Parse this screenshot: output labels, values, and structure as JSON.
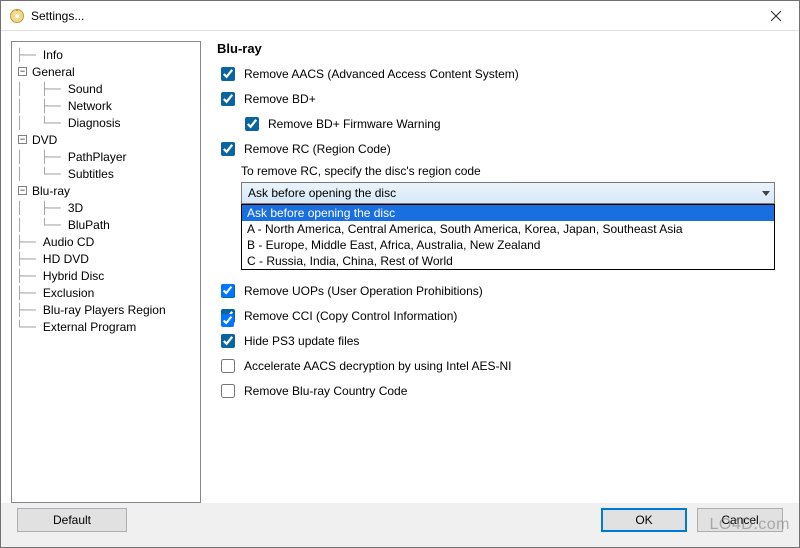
{
  "window": {
    "title": "Settings...",
    "close_label": "×"
  },
  "tree": {
    "items": [
      {
        "label": "Info",
        "depth": 1,
        "expander": "",
        "last": false
      },
      {
        "label": "General",
        "depth": 1,
        "expander": "-",
        "last": false
      },
      {
        "label": "Sound",
        "depth": 2,
        "expander": "",
        "last": false,
        "parentHasNext": true
      },
      {
        "label": "Network",
        "depth": 2,
        "expander": "",
        "last": false,
        "parentHasNext": true
      },
      {
        "label": "Diagnosis",
        "depth": 2,
        "expander": "",
        "last": true,
        "parentHasNext": true
      },
      {
        "label": "DVD",
        "depth": 1,
        "expander": "-",
        "last": false
      },
      {
        "label": "PathPlayer",
        "depth": 2,
        "expander": "",
        "last": false,
        "parentHasNext": true
      },
      {
        "label": "Subtitles",
        "depth": 2,
        "expander": "",
        "last": true,
        "parentHasNext": true
      },
      {
        "label": "Blu-ray",
        "depth": 1,
        "expander": "-",
        "last": false
      },
      {
        "label": "3D",
        "depth": 2,
        "expander": "",
        "last": false,
        "parentHasNext": true
      },
      {
        "label": "BluPath",
        "depth": 2,
        "expander": "",
        "last": true,
        "parentHasNext": true
      },
      {
        "label": "Audio CD",
        "depth": 1,
        "expander": "",
        "last": false
      },
      {
        "label": "HD DVD",
        "depth": 1,
        "expander": "",
        "last": false
      },
      {
        "label": "Hybrid Disc",
        "depth": 1,
        "expander": "",
        "last": false
      },
      {
        "label": "Exclusion",
        "depth": 1,
        "expander": "",
        "last": false
      },
      {
        "label": "Blu-ray Players Region",
        "depth": 1,
        "expander": "",
        "last": false
      },
      {
        "label": "External Program",
        "depth": 1,
        "expander": "",
        "last": true
      }
    ]
  },
  "content": {
    "title": "Blu-ray",
    "remove_aacs": "Remove AACS (Advanced Access Content System)",
    "remove_bdplus": "Remove BD+",
    "remove_bdplus_fw": "Remove BD+ Firmware Warning",
    "remove_rc": "Remove RC (Region Code)",
    "rc_subtext": "To remove RC, specify the disc's region code",
    "combo_value": "Ask before opening the disc",
    "options": [
      "Ask before opening the disc",
      "A - North America, Central America, South America, Korea, Japan, Southeast Asia",
      "B - Europe, Middle East, Africa, Australia, New Zealand",
      "C - Russia, India, China, Rest of World"
    ],
    "remove_uops": "Remove UOPs (User Operation Prohibitions)",
    "remove_cci": "Remove CCI (Copy Control Information)",
    "hide_ps3": "Hide PS3 update files",
    "accel_aacs": "Accelerate AACS decryption by using Intel AES-NI",
    "remove_cc": "Remove Blu-ray Country Code"
  },
  "footer": {
    "default": "Default",
    "ok": "OK",
    "cancel": "Cancel"
  },
  "watermark": "LO4D.com"
}
